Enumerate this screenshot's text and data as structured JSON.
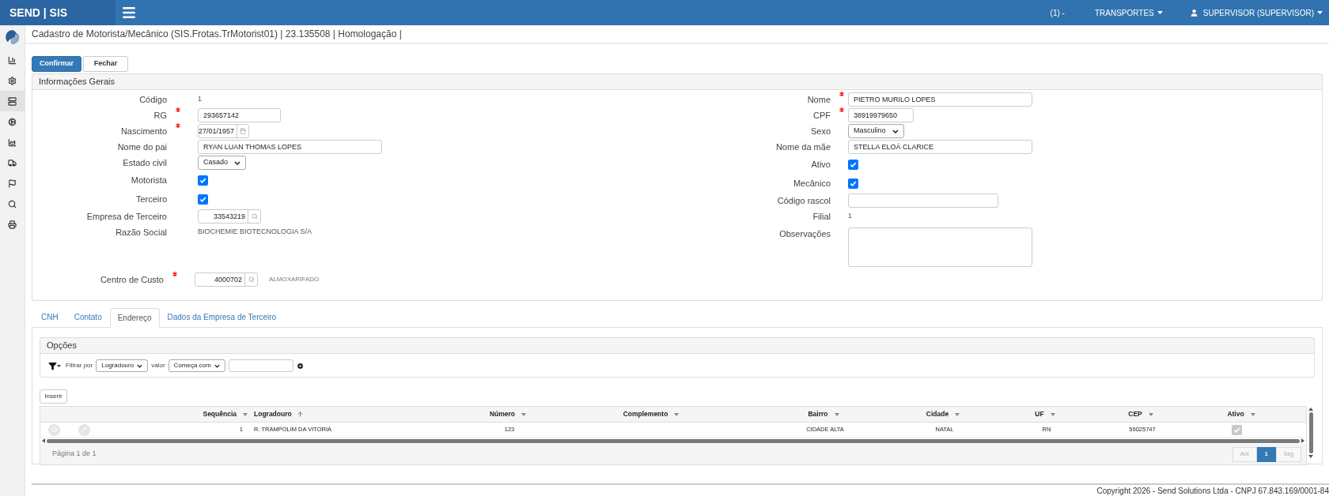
{
  "topbar": {
    "logo": "SEND | SIS",
    "company": {
      "prefix": "(1) -",
      "name": "TRANSPORTES"
    },
    "user": "SUPERVISOR (SUPERVISOR)"
  },
  "sidebar": {
    "items": [
      {
        "selected": false
      },
      {
        "selected": false
      },
      {
        "selected": true
      },
      {
        "selected": false
      },
      {
        "selected": false
      },
      {
        "selected": false
      },
      {
        "selected": false
      },
      {
        "selected": false
      },
      {
        "selected": false
      }
    ]
  },
  "page_title": "Cadastro de Motorista/Mecânico (SIS.Frotas.TrMotorist01) | 23.135508 | Homologação |",
  "actions": [
    {
      "label": "Confirmar",
      "primary": true
    },
    {
      "label": "Fechar",
      "primary": false
    }
  ],
  "general_info": {
    "title": "Informações Gerais",
    "left_fields": [
      {
        "kind": "static",
        "label": "Código",
        "value": "1",
        "required": false
      },
      {
        "kind": "text",
        "label": "RG",
        "value": "293657142",
        "required": true
      },
      {
        "kind": "date",
        "label": "Nascimento",
        "value": "27/01/1957",
        "required": true
      },
      {
        "kind": "text",
        "label": "Nome do pai",
        "value": "RYAN LUAN THOMAS LOPES",
        "required": false
      },
      {
        "kind": "select",
        "label": "Estado civil",
        "value": "Casado",
        "required": false
      },
      {
        "kind": "checkbox",
        "label": "Motorista",
        "checked": true,
        "required": false
      },
      {
        "kind": "checkbox",
        "label": "Terceiro",
        "checked": true,
        "required": false
      },
      {
        "kind": "lookup",
        "label": "Empresa de Terceiro",
        "value": "33543219",
        "required": false
      },
      {
        "kind": "static",
        "label": "Razão Social",
        "value": "BIOCHEMIE BIOTECNOLOGIA S/A",
        "required": false
      }
    ],
    "right_fields": [
      {
        "kind": "text",
        "label": "Nome",
        "value": "PIETRO MURILO LOPES",
        "required": true
      },
      {
        "kind": "text",
        "label": "CPF",
        "value": "38919979650",
        "required": true
      },
      {
        "kind": "select",
        "label": "Sexo",
        "value": "Masculino",
        "required": false
      },
      {
        "kind": "text",
        "label": "Nome da mãe",
        "value": "STELLA ELOÁ CLARICE",
        "required": false
      },
      {
        "kind": "checkbox",
        "label": "Ativo",
        "checked": true,
        "required": false
      },
      {
        "kind": "checkbox",
        "label": "Mecânico",
        "checked": true,
        "required": false
      },
      {
        "kind": "text",
        "label": "Código rascol",
        "required": false
      },
      {
        "kind": "static",
        "label": "Filial",
        "value": "1",
        "required": false
      },
      {
        "kind": "textarea",
        "label": "Observações",
        "required": false
      }
    ],
    "cost_center": {
      "kind": "lookup",
      "label": "Centro de Custo",
      "value": "4000702",
      "description": "ALMOXARIFADO",
      "required": true
    }
  },
  "tabs": [
    {
      "label": "CNH",
      "selected": false
    },
    {
      "label": "Contato",
      "selected": false
    },
    {
      "label": "Endereço",
      "selected": true
    },
    {
      "label": "Dados da Empresa de Terceiro",
      "selected": false
    }
  ],
  "options": {
    "title": "Opções",
    "filter_label": "Filtrar por",
    "filter_field": "Logradouro",
    "value_label": "valor",
    "operator": "Começa com"
  },
  "insert_button": "Inserir",
  "table": {
    "columns": [
      {
        "label": "Sequência",
        "sorted": false
      },
      {
        "label": "Logradouro",
        "sorted": true
      },
      {
        "label": "Número",
        "sorted": false
      },
      {
        "label": "Complemento",
        "sorted": false
      },
      {
        "label": "Bairro",
        "sorted": false
      },
      {
        "label": "Cidade",
        "sorted": false
      },
      {
        "label": "UF",
        "sorted": false
      },
      {
        "label": "CEP",
        "sorted": false
      },
      {
        "label": "Ativo",
        "sorted": false
      }
    ],
    "rows": [
      {
        "cells": [
          {
            "kind": "text",
            "text": "1"
          },
          {
            "kind": "text",
            "text": "R. TRAMPOLIM DA VITORIA"
          },
          {
            "kind": "text",
            "text": "123"
          },
          null,
          {
            "kind": "text",
            "text": "CIDADE ALTA"
          },
          {
            "kind": "text",
            "text": "NATAL"
          },
          {
            "kind": "text",
            "text": "RN"
          },
          {
            "kind": "text",
            "text": "59025747"
          },
          {
            "kind": "checkbox",
            "checked": true
          }
        ]
      }
    ],
    "page_info": "Página 1 de 1",
    "pager": [
      {
        "label": "Ant",
        "selected": false,
        "disabled": true
      },
      {
        "label": "1",
        "selected": true,
        "disabled": false
      },
      {
        "label": "Seg",
        "selected": false,
        "disabled": true
      }
    ]
  },
  "footer": "Copyright 2026 - Send Solutions Ltda - CNPJ 67.843.169/0001-84"
}
